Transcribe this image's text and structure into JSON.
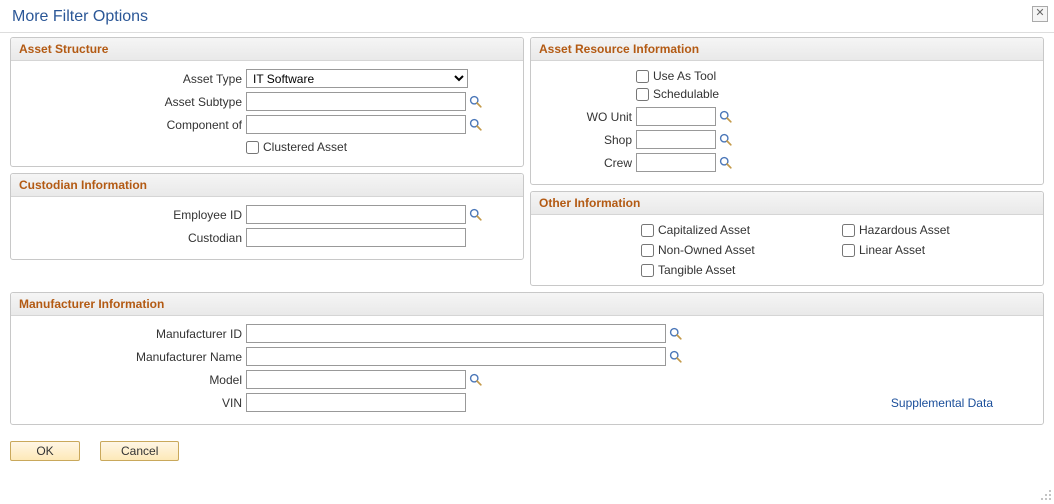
{
  "title": "More Filter Options",
  "sections": {
    "asset_structure": {
      "legend": "Asset Structure",
      "asset_type_label": "Asset Type",
      "asset_type_value": "IT Software",
      "asset_subtype_label": "Asset Subtype",
      "asset_subtype_value": "",
      "component_of_label": "Component of",
      "component_of_value": "",
      "clustered_asset_label": "Clustered Asset"
    },
    "asset_resource": {
      "legend": "Asset Resource Information",
      "use_as_tool_label": "Use As Tool",
      "schedulable_label": "Schedulable",
      "wo_unit_label": "WO Unit",
      "wo_unit_value": "",
      "shop_label": "Shop",
      "shop_value": "",
      "crew_label": "Crew",
      "crew_value": ""
    },
    "custodian": {
      "legend": "Custodian Information",
      "employee_id_label": "Employee ID",
      "employee_id_value": "",
      "custodian_label": "Custodian",
      "custodian_value": ""
    },
    "other": {
      "legend": "Other Information",
      "capitalized_label": "Capitalized Asset",
      "hazardous_label": "Hazardous Asset",
      "non_owned_label": "Non-Owned Asset",
      "linear_label": "Linear Asset",
      "tangible_label": "Tangible Asset"
    },
    "manufacturer": {
      "legend": "Manufacturer Information",
      "manufacturer_id_label": "Manufacturer ID",
      "manufacturer_id_value": "",
      "manufacturer_name_label": "Manufacturer Name",
      "manufacturer_name_value": "",
      "model_label": "Model",
      "model_value": "",
      "vin_label": "VIN",
      "vin_value": "",
      "supplemental_data_label": "Supplemental Data"
    }
  },
  "buttons": {
    "ok": "OK",
    "cancel": "Cancel"
  }
}
